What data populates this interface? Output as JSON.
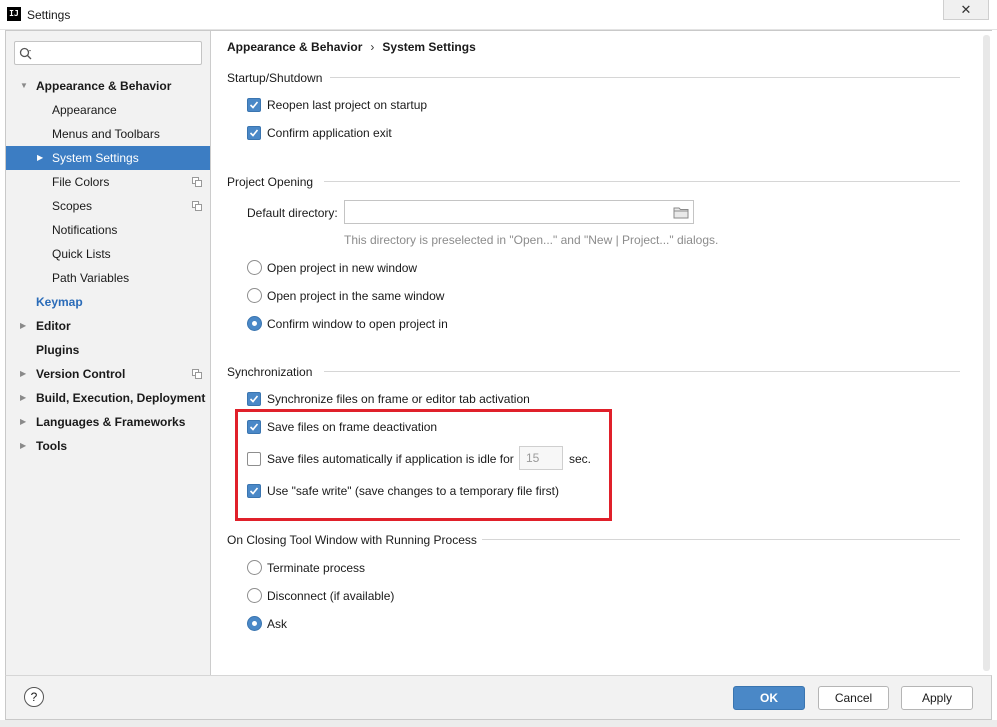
{
  "window": {
    "title": "Settings",
    "close_glyph": "✕",
    "app_icon_text": "IJ"
  },
  "search": {
    "placeholder": "",
    "value": "",
    "icon": "search-icon"
  },
  "sidebar": {
    "items": [
      {
        "label": "Appearance & Behavior",
        "expanded": true
      },
      {
        "label": "Appearance"
      },
      {
        "label": "Menus and Toolbars"
      },
      {
        "label": "System Settings",
        "selected": true
      },
      {
        "label": "File Colors"
      },
      {
        "label": "Scopes"
      },
      {
        "label": "Notifications"
      },
      {
        "label": "Quick Lists"
      },
      {
        "label": "Path Variables"
      },
      {
        "label": "Keymap"
      },
      {
        "label": "Editor"
      },
      {
        "label": "Plugins"
      },
      {
        "label": "Version Control"
      },
      {
        "label": "Build, Execution, Deployment"
      },
      {
        "label": "Languages & Frameworks"
      },
      {
        "label": "Tools"
      }
    ]
  },
  "breadcrumb": {
    "parent": "Appearance & Behavior",
    "separator": "›",
    "current": "System Settings"
  },
  "startup": {
    "title": "Startup/Shutdown",
    "reopen_label": "Reopen last project on startup",
    "reopen_checked": true,
    "confirm_exit_label": "Confirm application exit",
    "confirm_exit_checked": true
  },
  "project_opening": {
    "title": "Project Opening",
    "default_dir_label": "Default directory:",
    "default_dir_value": "",
    "hint": "This directory is preselected in \"Open...\" and \"New | Project...\" dialogs.",
    "options": [
      {
        "label": "Open project in new window",
        "selected": false
      },
      {
        "label": "Open project in the same window",
        "selected": false
      },
      {
        "label": "Confirm window to open project in",
        "selected": true
      }
    ]
  },
  "sync": {
    "title": "Synchronization",
    "sync_files_label": "Synchronize files on frame or editor tab activation",
    "sync_files_checked": true,
    "save_deactivation_label": "Save files on frame deactivation",
    "save_deactivation_checked": true,
    "save_idle_label": "Save files automatically if application is idle for",
    "save_idle_checked": false,
    "idle_seconds": "15",
    "idle_unit": "sec.",
    "safe_write_label": "Use \"safe write\" (save changes to a temporary file first)",
    "safe_write_checked": true
  },
  "closing": {
    "title": "On Closing Tool Window with Running Process",
    "options": [
      {
        "label": "Terminate process",
        "selected": false
      },
      {
        "label": "Disconnect (if available)",
        "selected": false
      },
      {
        "label": "Ask",
        "selected": true
      }
    ]
  },
  "footer": {
    "help": "?",
    "ok": "OK",
    "cancel": "Cancel",
    "apply": "Apply"
  },
  "colors": {
    "accent": "#4a88c7",
    "selection": "#3c7dc3",
    "highlight_box": "#e0202a",
    "link": "#2a6bb8"
  }
}
